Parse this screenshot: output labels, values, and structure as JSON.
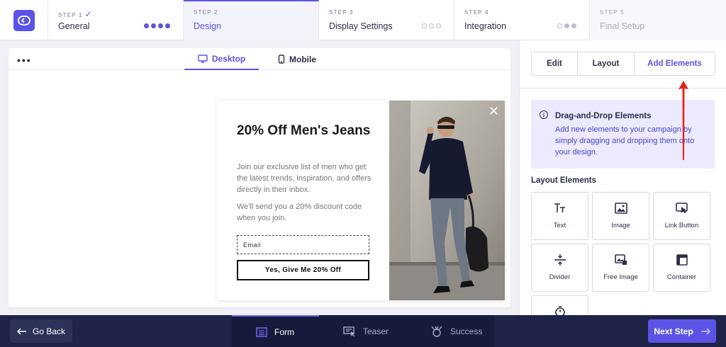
{
  "steps": [
    {
      "num": "STEP 1",
      "label": "General",
      "check": "✓"
    },
    {
      "num": "STEP 2",
      "label": "Design"
    },
    {
      "num": "STEP 3",
      "label": "Display Settings"
    },
    {
      "num": "STEP 4",
      "label": "Integration"
    },
    {
      "num": "STEP 5",
      "label": "Final Setup"
    }
  ],
  "preview": {
    "menu": "•••",
    "devices": {
      "desktop": "Desktop",
      "mobile": "Mobile"
    },
    "popup": {
      "title": "20% Off Men's Jeans",
      "body": "Join our exclusive list of men who get the latest trends, inspiration, and offers directly in their inbox.",
      "body2": "We'll send you a 20% discount code when you join.",
      "email_placeholder": "Email",
      "cta": "Yes, Give Me 20% Off",
      "close": "✕"
    }
  },
  "right": {
    "tabs": {
      "edit": "Edit",
      "layout": "Layout",
      "add": "Add Elements"
    },
    "info": {
      "icon": "i",
      "title": "Drag-and-Drop Elements",
      "text": "Add new elements to your campaign by simply dragging and dropping them onto your design."
    },
    "section_title": "Layout Elements",
    "elements": {
      "text": "Text",
      "image": "Image",
      "link_button": "Link Button",
      "divider": "Divider",
      "free_image": "Free Image",
      "container": "Container"
    }
  },
  "bottom": {
    "back": "Go Back",
    "tabs": {
      "form": "Form",
      "teaser": "Teaser",
      "success": "Success"
    },
    "next": "Next Step"
  },
  "colors": {
    "accent": "#5b53e6",
    "navy": "#1e2347",
    "annotation_arrow": "#e8241c"
  }
}
